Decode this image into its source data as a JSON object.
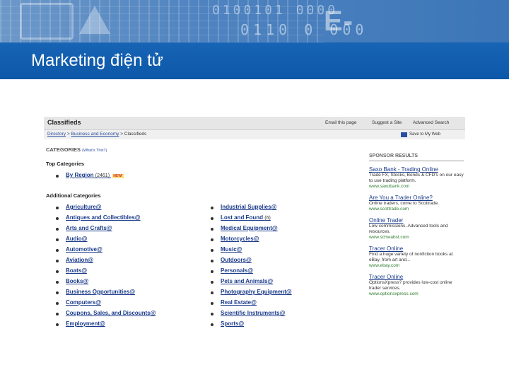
{
  "slide": {
    "title": "Marketing điện tử",
    "banner_text": "E-COMMERCE",
    "banner_digits_1": "0100101 0000",
    "banner_digits_2": "0110 0 000"
  },
  "toolbar": {
    "title": "Classifieds",
    "email_link": "Email this page",
    "suggest_link": "Suggest a Site",
    "advanced_link": "Advanced Search"
  },
  "breadcrumb": {
    "directory": "Directory",
    "sep": ">",
    "business": "Business and Economy",
    "current": "Classifieds",
    "save_label": "Save to My Web"
  },
  "categories_header": {
    "label": "CATEGORIES",
    "whats_this": "(What's This?)"
  },
  "top_categories": {
    "heading": "Top Categories",
    "items": [
      {
        "label": "By Region",
        "count": "(2461)",
        "badge": "NEW!"
      }
    ]
  },
  "additional_categories": {
    "heading": "Additional Categories",
    "left": [
      {
        "label": "Agriculture@"
      },
      {
        "label": "Antiques and Collectibles@"
      },
      {
        "label": "Arts and Crafts@"
      },
      {
        "label": "Audio@"
      },
      {
        "label": "Automotive@"
      },
      {
        "label": "Aviation@"
      },
      {
        "label": "Boats@"
      },
      {
        "label": "Books@"
      },
      {
        "label": "Business Opportunities@"
      },
      {
        "label": "Computers@"
      },
      {
        "label": "Coupons, Sales, and Discounts@"
      },
      {
        "label": "Employment@"
      }
    ],
    "right": [
      {
        "label": "Industrial Supplies@",
        "count": ""
      },
      {
        "label": "Lost and Found",
        "count": "(6)"
      },
      {
        "label": "Medical Equipment@",
        "count": ""
      },
      {
        "label": "Motorcycles@",
        "count": ""
      },
      {
        "label": "Music@",
        "count": ""
      },
      {
        "label": "Outdoors@",
        "count": ""
      },
      {
        "label": "Personals@",
        "count": ""
      },
      {
        "label": "Pets and Animals@",
        "count": ""
      },
      {
        "label": "Photography Equipment@",
        "count": ""
      },
      {
        "label": "Real Estate@",
        "count": ""
      },
      {
        "label": "Scientific Instruments@",
        "count": ""
      },
      {
        "label": "Sports@",
        "count": ""
      }
    ]
  },
  "sponsor": {
    "heading": "SPONSOR RESULTS",
    "ads": [
      {
        "title": "Saxo Bank - Trading Online",
        "desc": "Trade FX, Stocks, Bonds & CFD's on our easy to use trading platform.",
        "url": "www.saxobank.com"
      },
      {
        "title": "Are You a Trader Online?",
        "desc": "Online traders, come to Scottrade.",
        "url": "www.scottrade.com"
      },
      {
        "title": "Online Trader",
        "desc": "Low commissions. Advanced tools and resources.",
        "url": "www.schwabst.com"
      },
      {
        "title": "Tracer Online",
        "desc": "Find a huge variety of nonfiction books at eBay, from art and...",
        "url": "www.ebay.com"
      },
      {
        "title": "Tracer Online",
        "desc": "OptionsXpress? provides low-cost online trader services.",
        "url": "www.optionsxpress.com"
      }
    ]
  },
  "colors": {
    "banner": "#1763b4",
    "link": "#1a3a8a",
    "url_green": "#2f7f2f"
  }
}
